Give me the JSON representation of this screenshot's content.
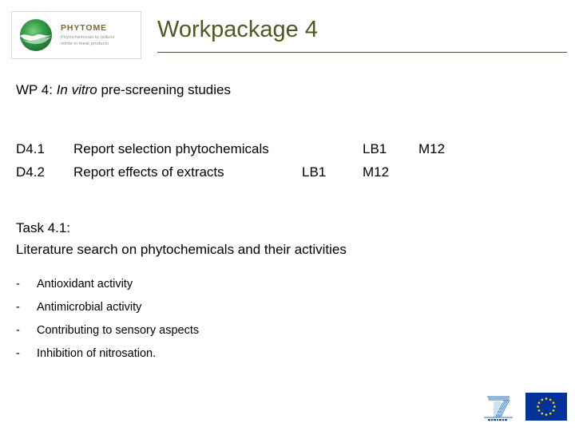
{
  "header": {
    "title": "Workpackage 4",
    "title_color": "#4c5a22",
    "rule_color": "#4c5a22",
    "logo": {
      "icon": "phytome-globe-icon",
      "name": "PHYTOME",
      "tagline_line1": "Phytochemicals to reduce",
      "tagline_line2": "nitrite in meat products",
      "name_color": "#7a6a2e",
      "globe_color": "#2f9e3f"
    }
  },
  "body": {
    "subtitle_prefix": "WP 4: ",
    "subtitle_italic": "In vitro",
    "subtitle_suffix": " pre-screening studies",
    "deliverables": {
      "rows": [
        {
          "id": "D4.1",
          "description": "Report selection phytochemicals",
          "partner": "LB1",
          "month": "M12"
        },
        {
          "id": "D4.2",
          "description": "Report effects of extracts",
          "partner": "LB1",
          "month": "M12"
        }
      ]
    },
    "task": {
      "heading": "Task 4.1:",
      "description": "Literature search on phytochemicals and their activities"
    },
    "activities": {
      "bullet_char": "-",
      "items": [
        {
          "label": "Antioxidant activity"
        },
        {
          "label": "Antimicrobial activity"
        },
        {
          "label": "Contributing to sensory aspects"
        },
        {
          "label": "Inhibition of nitrosation."
        }
      ]
    }
  },
  "footer": {
    "logos": [
      {
        "icon": "fp7-seventh-framework-programme-icon",
        "color": "#1f4e9c"
      },
      {
        "icon": "european-union-flag-icon",
        "color": "#003399",
        "star_color": "#ffcc00"
      }
    ]
  }
}
